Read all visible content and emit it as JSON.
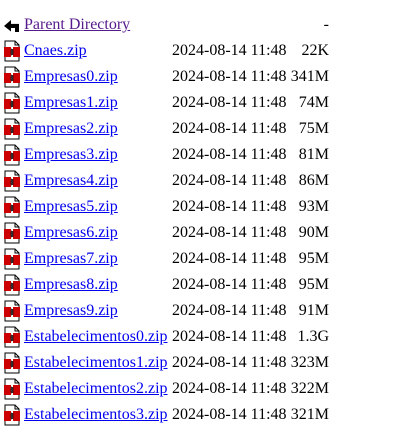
{
  "parent": {
    "label": "Parent Directory",
    "size": "-",
    "icon": "back-arrow-icon"
  },
  "files": [
    {
      "name": "Cnaes.zip",
      "date": "2024-08-14 11:48",
      "size": "22K",
      "icon": "compressed-file-icon"
    },
    {
      "name": "Empresas0.zip",
      "date": "2024-08-14 11:48",
      "size": "341M",
      "icon": "compressed-file-icon"
    },
    {
      "name": "Empresas1.zip",
      "date": "2024-08-14 11:48",
      "size": "74M",
      "icon": "compressed-file-icon"
    },
    {
      "name": "Empresas2.zip",
      "date": "2024-08-14 11:48",
      "size": "75M",
      "icon": "compressed-file-icon"
    },
    {
      "name": "Empresas3.zip",
      "date": "2024-08-14 11:48",
      "size": "81M",
      "icon": "compressed-file-icon"
    },
    {
      "name": "Empresas4.zip",
      "date": "2024-08-14 11:48",
      "size": "86M",
      "icon": "compressed-file-icon"
    },
    {
      "name": "Empresas5.zip",
      "date": "2024-08-14 11:48",
      "size": "93M",
      "icon": "compressed-file-icon"
    },
    {
      "name": "Empresas6.zip",
      "date": "2024-08-14 11:48",
      "size": "90M",
      "icon": "compressed-file-icon"
    },
    {
      "name": "Empresas7.zip",
      "date": "2024-08-14 11:48",
      "size": "95M",
      "icon": "compressed-file-icon"
    },
    {
      "name": "Empresas8.zip",
      "date": "2024-08-14 11:48",
      "size": "95M",
      "icon": "compressed-file-icon"
    },
    {
      "name": "Empresas9.zip",
      "date": "2024-08-14 11:48",
      "size": "91M",
      "icon": "compressed-file-icon"
    },
    {
      "name": "Estabelecimentos0.zip",
      "date": "2024-08-14 11:48",
      "size": "1.3G",
      "icon": "compressed-file-icon"
    },
    {
      "name": "Estabelecimentos1.zip",
      "date": "2024-08-14 11:48",
      "size": "323M",
      "icon": "compressed-file-icon"
    },
    {
      "name": "Estabelecimentos2.zip",
      "date": "2024-08-14 11:48",
      "size": "322M",
      "icon": "compressed-file-icon"
    },
    {
      "name": "Estabelecimentos3.zip",
      "date": "2024-08-14 11:48",
      "size": "321M",
      "icon": "compressed-file-icon"
    }
  ],
  "colors": {
    "link": "#0000ee",
    "visited_link": "#551a8b",
    "icon_red": "#cc0000"
  }
}
